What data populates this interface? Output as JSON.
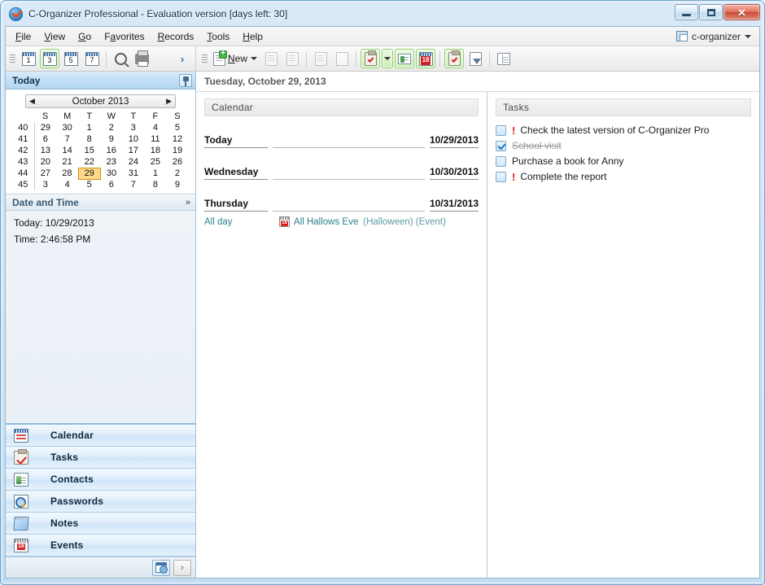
{
  "window": {
    "title": "C-Organizer Professional - Evaluation version [days left: 30]",
    "app_icon": "checkmark-circle-icon",
    "minimize_label": "–",
    "maximize_label": "",
    "close_label": "✕"
  },
  "menubar": {
    "items": [
      {
        "label": "File",
        "accel": "F"
      },
      {
        "label": "View",
        "accel": "V"
      },
      {
        "label": "Go",
        "accel": "G"
      },
      {
        "label": "Favorites",
        "accel": "a"
      },
      {
        "label": "Records",
        "accel": "R"
      },
      {
        "label": "Tools",
        "accel": "T"
      },
      {
        "label": "Help",
        "accel": "H"
      }
    ],
    "profile": "c-organizer"
  },
  "toolbar_left": {
    "buttons": [
      {
        "name": "day-view-1",
        "label": "1",
        "selected": false
      },
      {
        "name": "day-view-3",
        "label": "3",
        "selected": true
      },
      {
        "name": "day-view-5",
        "label": "5",
        "selected": false
      },
      {
        "name": "day-view-7",
        "label": "7",
        "selected": false
      }
    ],
    "search": "search-icon",
    "print": "print-icon",
    "overflow": "›"
  },
  "toolbar_right": {
    "new_label": "New",
    "new_accel": "N",
    "dropdown": "▾"
  },
  "sidebar": {
    "header": "Today",
    "minical": {
      "title": "October 2013",
      "prev": "◀",
      "next": "▶",
      "weekday_headers": [
        "S",
        "M",
        "T",
        "W",
        "T",
        "F",
        "S"
      ],
      "week_numbers": [
        40,
        41,
        42,
        43,
        44,
        45
      ],
      "weeks": [
        [
          {
            "d": "29",
            "dim": true
          },
          {
            "d": "30",
            "dim": true
          },
          {
            "d": "1"
          },
          {
            "d": "2"
          },
          {
            "d": "3"
          },
          {
            "d": "4"
          },
          {
            "d": "5"
          }
        ],
        [
          {
            "d": "6"
          },
          {
            "d": "7"
          },
          {
            "d": "8"
          },
          {
            "d": "9"
          },
          {
            "d": "10"
          },
          {
            "d": "11"
          },
          {
            "d": "12"
          }
        ],
        [
          {
            "d": "13"
          },
          {
            "d": "14",
            "bold": true
          },
          {
            "d": "15"
          },
          {
            "d": "16"
          },
          {
            "d": "17"
          },
          {
            "d": "18"
          },
          {
            "d": "19"
          }
        ],
        [
          {
            "d": "20"
          },
          {
            "d": "21"
          },
          {
            "d": "22"
          },
          {
            "d": "23"
          },
          {
            "d": "24"
          },
          {
            "d": "25"
          },
          {
            "d": "26"
          }
        ],
        [
          {
            "d": "27"
          },
          {
            "d": "28"
          },
          {
            "d": "29",
            "today": true
          },
          {
            "d": "30"
          },
          {
            "d": "31",
            "bold": true
          },
          {
            "d": "1",
            "dim": true
          },
          {
            "d": "2",
            "dim": true
          }
        ],
        [
          {
            "d": "3",
            "dim": true
          },
          {
            "d": "4",
            "dim": true
          },
          {
            "d": "5",
            "dim": true
          },
          {
            "d": "6",
            "dim": true
          },
          {
            "d": "7",
            "dim": true
          },
          {
            "d": "8",
            "dim": true
          },
          {
            "d": "9",
            "dim": true
          }
        ]
      ]
    },
    "datetime": {
      "header": "Date and Time",
      "collapse": "»",
      "today_line": "Today: 10/29/2013",
      "time_line": "Time: 2:46:58 PM"
    },
    "nav_items": [
      {
        "label": "Calendar",
        "icon": "calendar-icon"
      },
      {
        "label": "Tasks",
        "icon": "clipboard-check-icon"
      },
      {
        "label": "Contacts",
        "icon": "contact-card-icon"
      },
      {
        "label": "Passwords",
        "icon": "key-magnifier-icon"
      },
      {
        "label": "Notes",
        "icon": "notepad-icon"
      },
      {
        "label": "Events",
        "icon": "event-calendar-icon"
      }
    ],
    "footer": {
      "calendar_button": "calendar-clock-icon",
      "expand_button": "›"
    }
  },
  "main": {
    "date_header": "Tuesday, October 29, 2013",
    "calendar_pane": {
      "title": "Calendar",
      "days": [
        {
          "name": "Today",
          "date": "10/29/2013"
        },
        {
          "name": "Wednesday",
          "date": "10/30/2013"
        },
        {
          "name": "Thursday",
          "date": "10/31/2013"
        }
      ],
      "event": {
        "time": "All day",
        "icon": "event-calendar-icon",
        "name": "All Hallows Eve",
        "meta": "(Halloween) (Event)"
      }
    },
    "tasks_pane": {
      "title": "Tasks",
      "items": [
        {
          "text": "Check the latest version of C-Organizer Pro",
          "checked": false,
          "priority": true
        },
        {
          "text": "School visit",
          "checked": true,
          "priority": false
        },
        {
          "text": "Purchase a book for Anny",
          "checked": false,
          "priority": false
        },
        {
          "text": "Complete the report",
          "checked": false,
          "priority": true
        }
      ],
      "priority_marker": "!"
    }
  },
  "colors": {
    "accent_blue": "#3b8fd4",
    "selection_green": "#8fd06a",
    "today_highlight": "#ffd98a",
    "today_border": "#d98b14",
    "event_teal": "#2c7f8c",
    "priority_red": "#d52020",
    "title_text": "#0b2a48"
  }
}
